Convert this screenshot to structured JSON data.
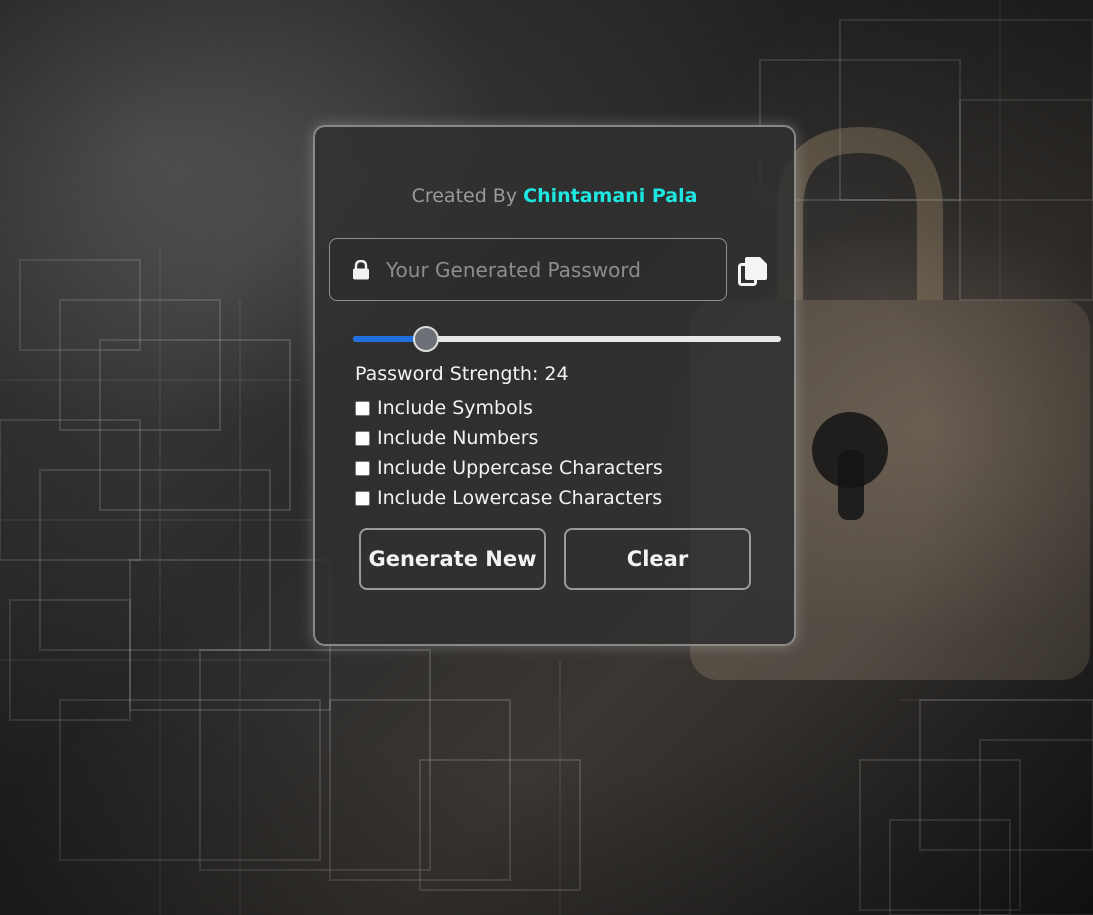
{
  "credit": {
    "prefix": "Created By",
    "author": "Chintamani Pala",
    "author_color": "#1ee6e0"
  },
  "password_field": {
    "value": "",
    "placeholder": "Your Generated Password",
    "icon": "lock-icon"
  },
  "copy": {
    "icon": "copy-icon"
  },
  "length_slider": {
    "value": 24,
    "fraction": 0.17,
    "fill_color": "#1f6fe0"
  },
  "strength": {
    "label": "Password Strength: 24"
  },
  "options": [
    {
      "label": "Include Symbols",
      "checked": false
    },
    {
      "label": "Include Numbers",
      "checked": false
    },
    {
      "label": "Include Uppercase Characters",
      "checked": false
    },
    {
      "label": "Include Lowercase Characters",
      "checked": false
    }
  ],
  "buttons": {
    "generate": "Generate New",
    "clear": "Clear"
  }
}
